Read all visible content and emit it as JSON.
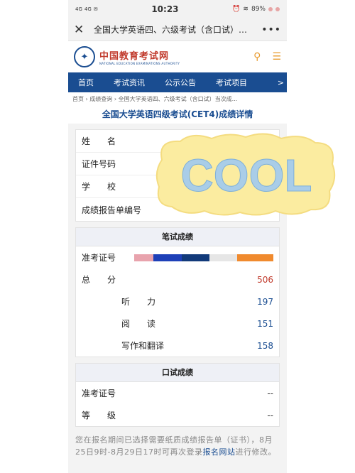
{
  "status": {
    "signal1": "4G",
    "signal2": "4G",
    "time": "10:23",
    "battery": "89%"
  },
  "titlebar": {
    "title": "全国大学英语四、六级考试（含口试）…"
  },
  "logo": {
    "cn": "中国教育考试网",
    "en": "NATIONAL EDUCATION EXAMINATIONS AUTHORITY"
  },
  "nav": {
    "items": [
      "首页",
      "考试资讯",
      "公示公告",
      "考试项目"
    ],
    "arrow": ">"
  },
  "breadcrumb": "首页 › 成绩查询 › 全国大学英语四、六级考试（含口试）当次成...",
  "page_title": "全国大学英语四级考试(CET4)成绩详情",
  "info": {
    "rows": [
      {
        "label": "姓　　名",
        "value": "**"
      },
      {
        "label": "证件号码",
        "value": ""
      },
      {
        "label": "学　　校",
        "value": ""
      },
      {
        "label": "成绩报告单编号",
        "value": ""
      }
    ]
  },
  "written": {
    "header": "笔试成绩",
    "ticket_label": "准考证号",
    "total_label": "总　　分",
    "total": "506",
    "listening_label": "听　　力",
    "listening": "197",
    "reading_label": "阅　　读",
    "reading": "151",
    "writing_label": "写作和翻译",
    "writing": "158"
  },
  "oral": {
    "header": "口试成绩",
    "ticket_label": "准考证号",
    "ticket": "--",
    "grade_label": "等　　级",
    "grade": "--"
  },
  "note": {
    "text": "您在报名期间已选择需要纸质成绩报告单（证书），8月25日9时-8月29日17时可再次登录",
    "link": "报名网站",
    "tail": "进行修改。"
  },
  "sticker": {
    "text": "COOL"
  },
  "colors": {
    "brand": "#1a4d91",
    "accent": "#e89b2e",
    "red": "#c0392b"
  }
}
